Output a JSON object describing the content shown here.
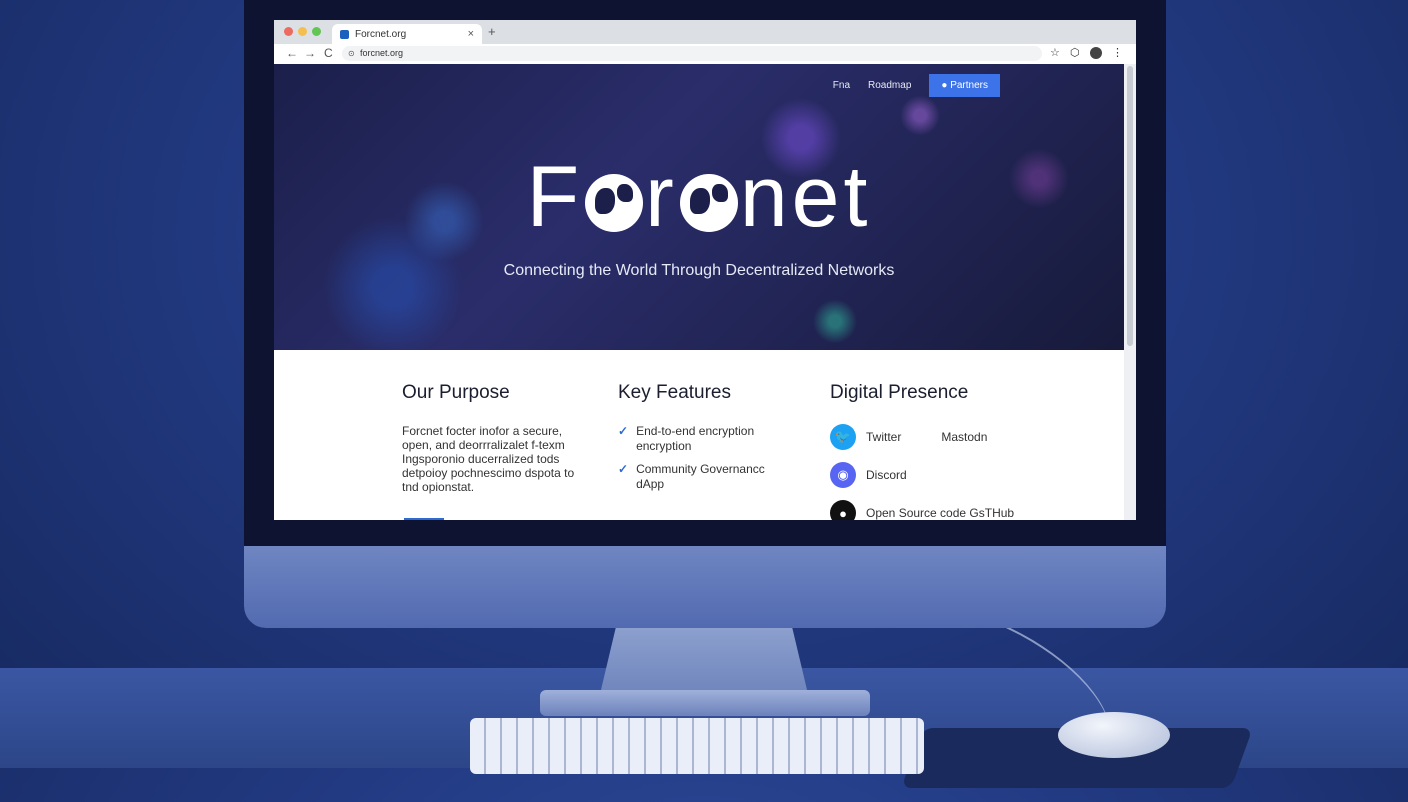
{
  "browser": {
    "tab_title": "Forcnet.org",
    "tab_close": "×",
    "new_tab": "+",
    "url": "forcnet.org",
    "back": "←",
    "forward": "→",
    "reload": "C"
  },
  "nav": {
    "items": [
      "Fna",
      "Roadmap"
    ],
    "cta_label": "Partners"
  },
  "hero": {
    "logo_prefix": "F",
    "logo_middle": "r",
    "logo_suffix": "net",
    "tagline": "Connecting the World Through Decentralized Networks"
  },
  "sections": {
    "purpose": {
      "heading": "Our Purpose",
      "text": "Forcnet focter inofor a secure, open, and deorrralizalet f-texm Ingsporonio ducerralized tods detpoioy pochnescimo dspota to tnd opionstat."
    },
    "features": {
      "heading": "Key Features",
      "items": [
        "End-to-end encryption encryption",
        "Community Governancc dApp"
      ]
    },
    "presence": {
      "heading": "Digital Presence",
      "twitter": "Twitter",
      "mastodon": "Mastodn",
      "discord": "Discord",
      "github": "Open Source code GsTHub"
    }
  },
  "colors": {
    "accent": "#3c73e8",
    "twitter": "#1da1f2",
    "discord": "#5865f2",
    "github": "#111111"
  }
}
